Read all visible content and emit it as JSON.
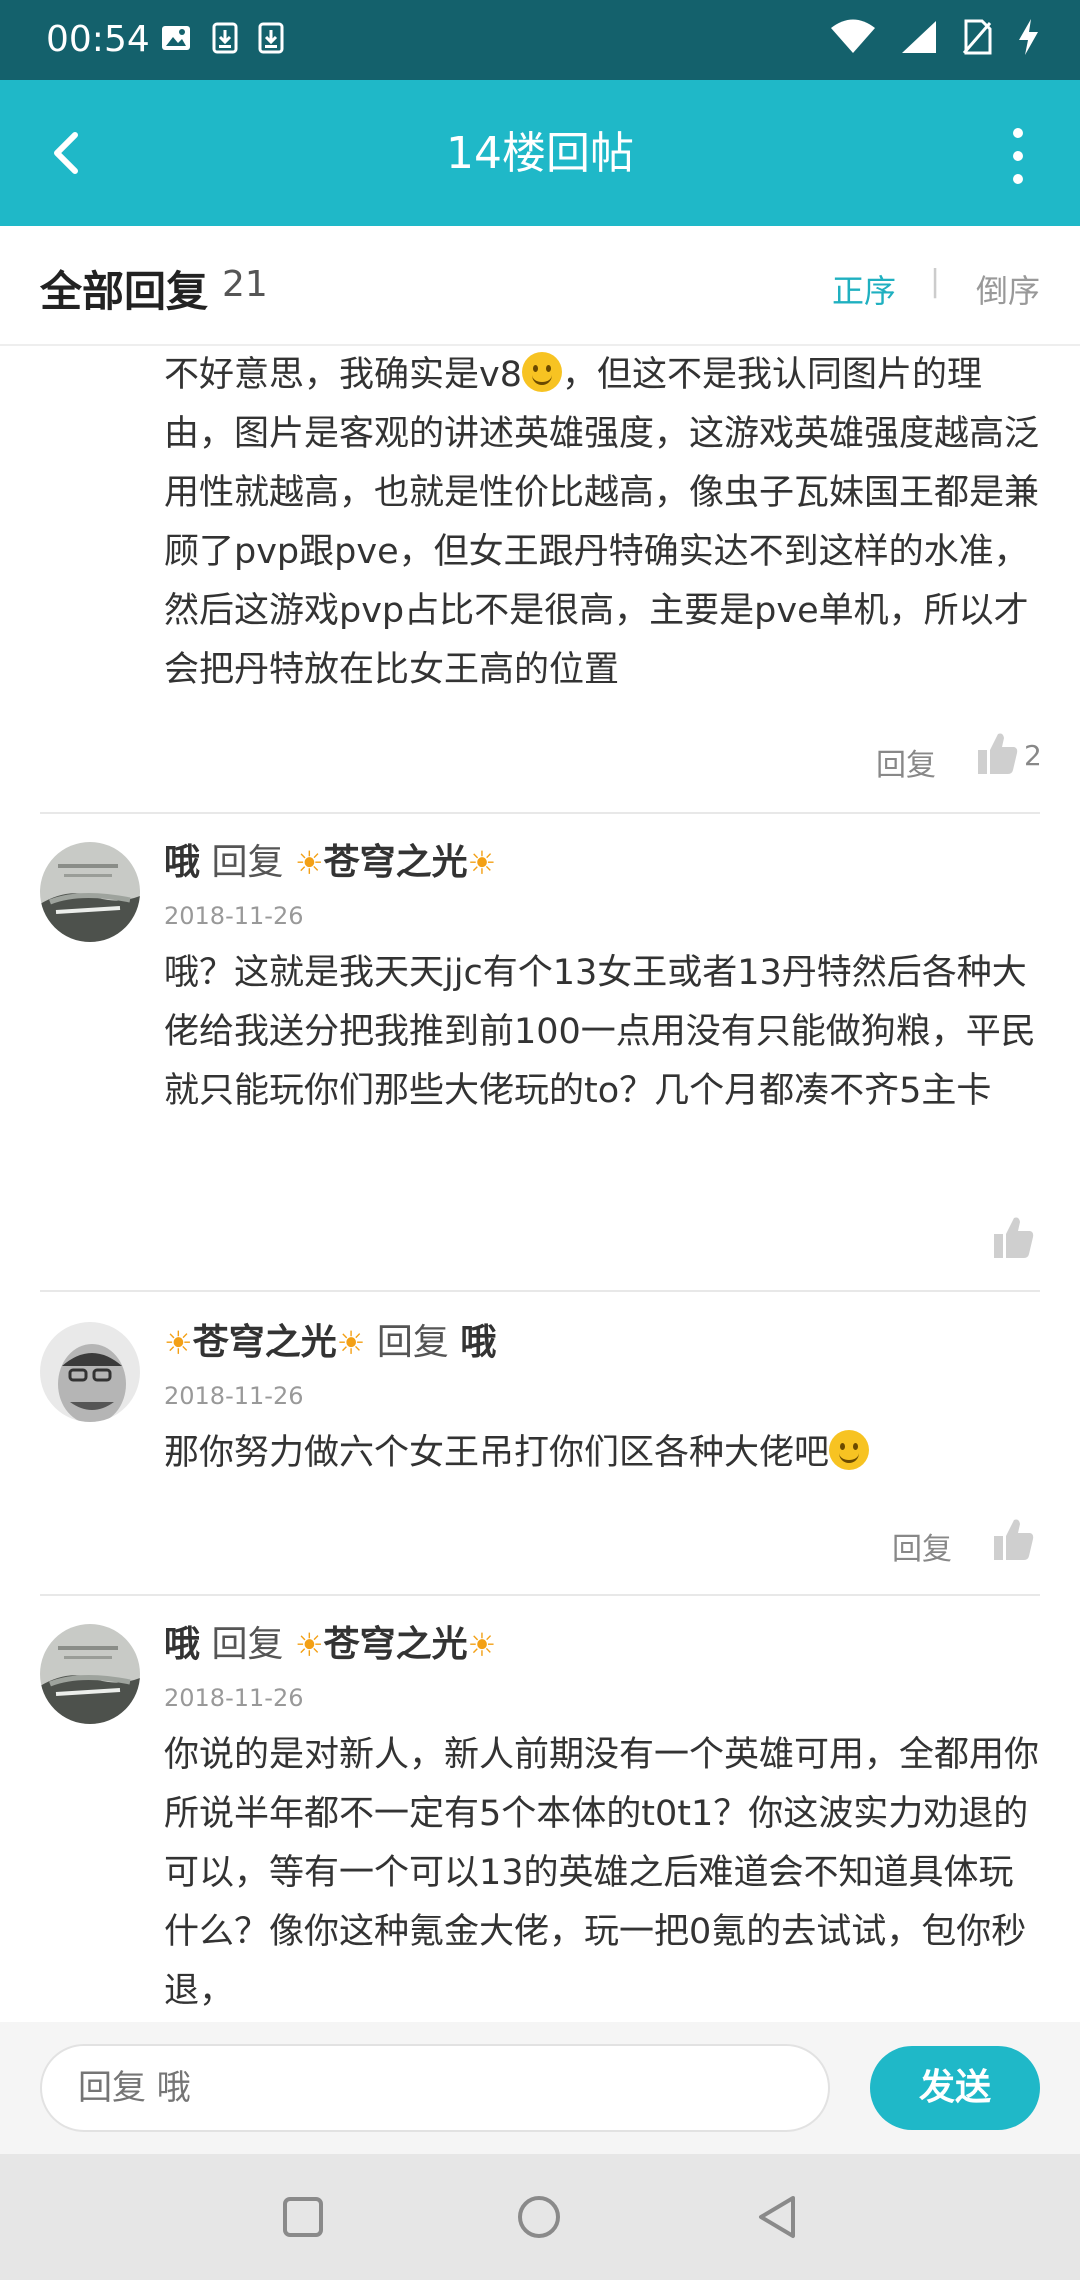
{
  "status_bar": {
    "time": "00:54",
    "left_icons": [
      "image-icon",
      "download-icon",
      "download-icon"
    ],
    "right_icons": [
      "wifi-icon",
      "signal-icon",
      "no-sim-icon",
      "charging-icon"
    ]
  },
  "app_bar": {
    "title": "14楼回帖",
    "back_icon": "back-arrow-icon",
    "more_icon": "more-vertical-icon"
  },
  "header": {
    "title": "全部回复",
    "count": "21",
    "sort_asc": "正序",
    "separator": "|",
    "sort_desc": "倒序",
    "active_color": "#1fb0c0"
  },
  "posts": [
    {
      "text_before_emoji": "不好意思，我确实是v8",
      "text_after_emoji": "，但这不是我认同图片的理由，图片是客观的讲述英雄强度，这游戏英雄强度越高泛用性就越高，也就是性价比越高，像虫子瓦妹国王都是兼顾了pvp跟pve，但女王跟丹特确实达不到这样的水准，然后这游戏pvp占比不是很高，主要是pve单机，所以才会把丹特放在比女王高的位置",
      "reply_label": "回复",
      "like_count": "2"
    },
    {
      "user": "哦",
      "reply_word": "回复",
      "target": "苍穹之光",
      "date": "2018-11-26",
      "text": "哦？这就是我天天jjc有个13女王或者13丹特然后各种大佬给我送分把我推到前100一点用没有只能做狗粮，平民就只能玩你们那些大佬玩的to？几个月都凑不齐5主卡"
    },
    {
      "user": "苍穹之光",
      "reply_word": "回复",
      "target": "哦",
      "date": "2018-11-26",
      "text_before_emoji": "那你努力做六个女王吊打你们区各种大佬吧",
      "reply_label": "回复"
    },
    {
      "user": "哦",
      "reply_word": "回复",
      "target": "苍穹之光",
      "date": "2018-11-26",
      "text": "你说的是对新人，新人前期没有一个英雄可用，全都用你所说半年都不一定有5个本体的t0t1？你这波实力劝退的可以，等有一个可以13的英雄之后难道会不知道具体玩什么？像你这种氪金大佬，玩一把0氪的去试试，包你秒退，"
    }
  ],
  "bottom_bar": {
    "input_placeholder": "回复 哦",
    "send_label": "发送",
    "accent": "#1fb8c8"
  },
  "nav_bar": {
    "icons": [
      "recent-apps-icon",
      "home-icon",
      "back-triangle-icon"
    ]
  }
}
